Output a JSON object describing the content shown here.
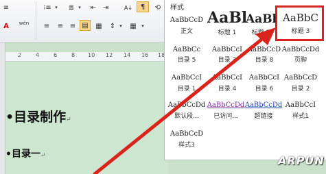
{
  "ribbon": {
    "row1": [
      "≡",
      "⁝≡",
      "▾",
      "≣",
      "▾",
      "⇤",
      "⇥",
      "A↓",
      "¶",
      "⟲"
    ],
    "row2": [
      "A",
      "wén",
      "≡",
      "≡",
      "≡",
      "▤",
      "▦",
      "↕",
      "▾",
      "▦",
      "▾"
    ]
  },
  "ruler": {
    "ticks": [
      "2",
      "4",
      "6",
      "8",
      "10",
      "12",
      "14",
      "16",
      "18"
    ]
  },
  "document": {
    "heading_main": "目录制作",
    "heading_sub": "目录一",
    "bullet_mark": "•",
    "return_mark": "↵"
  },
  "styles_panel": {
    "title": "样式",
    "styles": [
      {
        "sample": "AaBbCcD",
        "label": "正文"
      },
      {
        "sample": "AaBl",
        "label": "标题 1"
      },
      {
        "sample": "AaBb",
        "label": "标题 2"
      },
      {
        "sample": "AaBbC",
        "label": "标题 3"
      },
      {
        "sample": "AaBbCc",
        "label": "目录 5"
      },
      {
        "sample": "AaBbCcI",
        "label": "目录 3"
      },
      {
        "sample": "AaBbCcD",
        "label": "目录 8"
      },
      {
        "sample": "AaBbCcDd",
        "label": "页脚"
      },
      {
        "sample": "AaBbCcI",
        "label": "目录 1"
      },
      {
        "sample": "AaBbCcI",
        "label": "目录 4"
      },
      {
        "sample": "AaBbCcI",
        "label": "目录 6"
      },
      {
        "sample": "AaBbCcD",
        "label": "目录 2"
      },
      {
        "sample": "AaBbCcDd",
        "label": "默认段..."
      },
      {
        "sample": "AaBbCcDd",
        "label": "已访问..."
      },
      {
        "sample": "AaBbCcDd",
        "label": "超链接"
      },
      {
        "sample": "AaBbCcI",
        "label": "样式1"
      },
      {
        "sample": "AaBbCcD",
        "label": "样式3"
      }
    ],
    "selected": "标题 3",
    "highlight_color": "#d9241d"
  },
  "watermark": "ARPUN"
}
